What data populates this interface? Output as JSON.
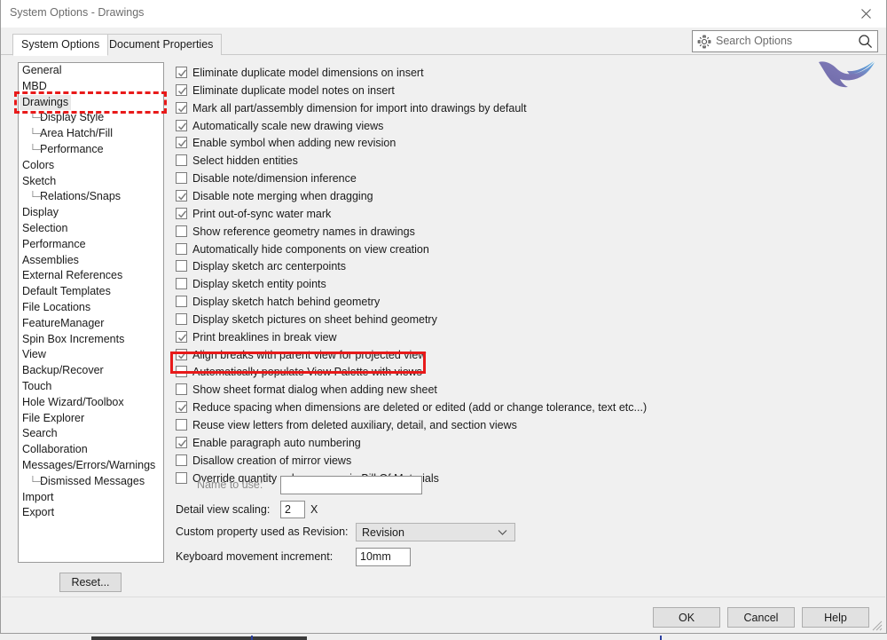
{
  "window": {
    "title": "System Options - Drawings",
    "close_icon": "close-x-icon"
  },
  "tabs": [
    {
      "label": "System Options",
      "active": true
    },
    {
      "label": "Document Properties",
      "active": false
    }
  ],
  "search": {
    "placeholder": "Search Options",
    "value": "",
    "gear_icon": "gear-icon",
    "magnifier_icon": "search-icon"
  },
  "logo": {
    "name": "bird-logo"
  },
  "sidebar": {
    "items": [
      {
        "label": "General",
        "level": 0,
        "selected": false
      },
      {
        "label": "MBD",
        "level": 0,
        "selected": false
      },
      {
        "label": "Drawings",
        "level": 0,
        "selected": true
      },
      {
        "label": "Display Style",
        "level": 1,
        "selected": false
      },
      {
        "label": "Area Hatch/Fill",
        "level": 1,
        "selected": false
      },
      {
        "label": "Performance",
        "level": 1,
        "selected": false
      },
      {
        "label": "Colors",
        "level": 0,
        "selected": false
      },
      {
        "label": "Sketch",
        "level": 0,
        "selected": false
      },
      {
        "label": "Relations/Snaps",
        "level": 1,
        "selected": false
      },
      {
        "label": "Display",
        "level": 0,
        "selected": false
      },
      {
        "label": "Selection",
        "level": 0,
        "selected": false
      },
      {
        "label": "Performance",
        "level": 0,
        "selected": false
      },
      {
        "label": "Assemblies",
        "level": 0,
        "selected": false
      },
      {
        "label": "External References",
        "level": 0,
        "selected": false
      },
      {
        "label": "Default Templates",
        "level": 0,
        "selected": false
      },
      {
        "label": "File Locations",
        "level": 0,
        "selected": false
      },
      {
        "label": "FeatureManager",
        "level": 0,
        "selected": false
      },
      {
        "label": "Spin Box Increments",
        "level": 0,
        "selected": false
      },
      {
        "label": "View",
        "level": 0,
        "selected": false
      },
      {
        "label": "Backup/Recover",
        "level": 0,
        "selected": false
      },
      {
        "label": "Touch",
        "level": 0,
        "selected": false
      },
      {
        "label": "Hole Wizard/Toolbox",
        "level": 0,
        "selected": false
      },
      {
        "label": "File Explorer",
        "level": 0,
        "selected": false
      },
      {
        "label": "Search",
        "level": 0,
        "selected": false
      },
      {
        "label": "Collaboration",
        "level": 0,
        "selected": false
      },
      {
        "label": "Messages/Errors/Warnings",
        "level": 0,
        "selected": false
      },
      {
        "label": "Dismissed Messages",
        "level": 1,
        "selected": false
      },
      {
        "label": "Import",
        "level": 0,
        "selected": false
      },
      {
        "label": "Export",
        "level": 0,
        "selected": false
      }
    ]
  },
  "options": {
    "checkboxes": [
      {
        "label": "Eliminate duplicate model dimensions on insert",
        "checked": true
      },
      {
        "label": "Eliminate duplicate model notes on insert",
        "checked": true
      },
      {
        "label": "Mark all part/assembly dimension for import into drawings by default",
        "checked": true
      },
      {
        "label": "Automatically scale new drawing views",
        "checked": true
      },
      {
        "label": "Enable symbol when adding new revision",
        "checked": true
      },
      {
        "label": "Select hidden entities",
        "checked": false
      },
      {
        "label": "Disable note/dimension inference",
        "checked": false
      },
      {
        "label": "Disable note merging when dragging",
        "checked": true
      },
      {
        "label": "Print out-of-sync water mark",
        "checked": true
      },
      {
        "label": "Show reference geometry names in drawings",
        "checked": false
      },
      {
        "label": "Automatically hide components on view creation",
        "checked": false
      },
      {
        "label": "Display sketch arc centerpoints",
        "checked": false
      },
      {
        "label": "Display sketch entity points",
        "checked": false
      },
      {
        "label": "Display sketch hatch behind geometry",
        "checked": false
      },
      {
        "label": "Display sketch pictures on sheet behind geometry",
        "checked": false
      },
      {
        "label": "Print breaklines in break view",
        "checked": true
      },
      {
        "label": "Align breaks with parent view for projected view",
        "checked": true
      },
      {
        "label": "Automatically populate View Palette with views",
        "checked": false
      },
      {
        "label": "Show sheet format dialog when adding new sheet",
        "checked": false
      },
      {
        "label": "Reduce spacing when dimensions are deleted or edited (add or change tolerance, text etc...)",
        "checked": true
      },
      {
        "label": "Reuse view letters from deleted auxiliary, detail, and section views",
        "checked": false
      },
      {
        "label": "Enable paragraph auto numbering",
        "checked": true
      },
      {
        "label": "Disallow creation of mirror views",
        "checked": false
      },
      {
        "label": "Override quantity column name in Bill Of Materials",
        "checked": false
      }
    ],
    "name_to_use": {
      "label": "Name to use:",
      "value": "",
      "enabled": false
    },
    "detail_view_scaling": {
      "label": "Detail view scaling:",
      "value": "2",
      "suffix": "X"
    },
    "custom_property_revision": {
      "label": "Custom property used as Revision:",
      "value": "Revision",
      "chevron_icon": "chevron-down-icon"
    },
    "keyboard_increment": {
      "label": "Keyboard movement increment:",
      "value": "10mm"
    }
  },
  "buttons": {
    "reset": "Reset...",
    "ok": "OK",
    "cancel": "Cancel",
    "help": "Help"
  },
  "annotations": {
    "dashed_highlight_target": "Drawings",
    "solid_highlight_target": "Automatically populate View Palette with views",
    "highlight_color": "#e81a1a"
  }
}
